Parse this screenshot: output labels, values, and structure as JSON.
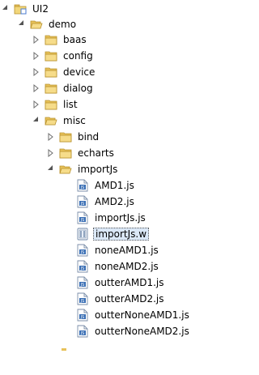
{
  "tree": {
    "project": {
      "label": "UI2",
      "icon": "project-folder-icon",
      "expanded": true
    },
    "items": [
      {
        "label": "demo",
        "type": "folder",
        "expanded": true
      },
      {
        "label": "baas",
        "type": "folder",
        "expanded": false
      },
      {
        "label": "config",
        "type": "folder",
        "expanded": false
      },
      {
        "label": "device",
        "type": "folder",
        "expanded": false
      },
      {
        "label": "dialog",
        "type": "folder",
        "expanded": false
      },
      {
        "label": "list",
        "type": "folder",
        "expanded": false
      },
      {
        "label": "misc",
        "type": "folder",
        "expanded": true
      },
      {
        "label": "bind",
        "type": "folder",
        "expanded": false
      },
      {
        "label": "echarts",
        "type": "folder",
        "expanded": false
      },
      {
        "label": "importJs",
        "type": "folder",
        "expanded": true
      },
      {
        "label": "AMD1.js",
        "type": "js-file"
      },
      {
        "label": "AMD2.js",
        "type": "js-file"
      },
      {
        "label": "importJs.js",
        "type": "js-file"
      },
      {
        "label": "importJs.w",
        "type": "w-file",
        "selected": true
      },
      {
        "label": "noneAMD1.js",
        "type": "js-file"
      },
      {
        "label": "noneAMD2.js",
        "type": "js-file"
      },
      {
        "label": "outterAMD1.js",
        "type": "js-file"
      },
      {
        "label": "outterAMD2.js",
        "type": "js-file"
      },
      {
        "label": "outterNoneAMD1.js",
        "type": "js-file"
      },
      {
        "label": "outterNoneAMD2.js",
        "type": "js-file"
      }
    ]
  },
  "colors": {
    "folder": "#e8c25a",
    "folder_dark": "#b8912c",
    "twistie": "#6e6e6e",
    "selection_bg": "#dbe8f7",
    "js_badge": "#3a6fb5"
  }
}
